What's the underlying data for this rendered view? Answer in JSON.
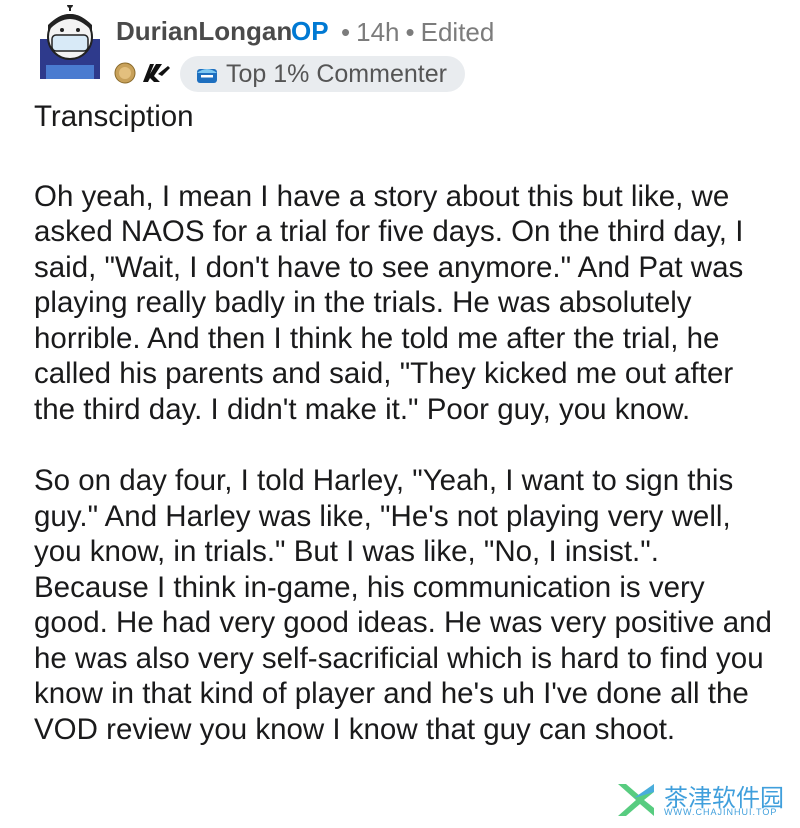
{
  "comment": {
    "author": "DurianLongan",
    "op_label": "OP",
    "age": "14h",
    "edited_label": "Edited",
    "badge": {
      "label": "Top 1% Commenter",
      "icon": "commenter-badge-icon"
    },
    "flair_icons": [
      "edg-logo-icon",
      "paper-rex-logo-icon"
    ],
    "paragraphs": [
      "Transciption",
      "Oh yeah, I mean I have a story about this but like, we asked NAOS for a trial for five days. On the third day, I said, \"Wait, I don't have to see anymore.\" And Pat was playing really badly in the trials. He was absolutely horrible. And then I think he told me after the trial, he called his parents and said, \"They kicked me out after the third day. I didn't make it.\" Poor guy, you know.",
      "So on day four, I told Harley, \"Yeah, I want to sign this guy.\" And Harley was like, \"He's not playing very well, you know, in trials.\" But I was like, \"No, I insist.\". Because I think in-game, his communication is very good. He had very good ideas. He was very positive and he was also very self-sacrificial which is hard to find you know in that kind of player and he's uh I've done all the VOD review you know I know that guy can shoot."
    ]
  },
  "watermark": {
    "name": "茶津软件园",
    "url": "WWW.CHAJINHUI.TOP"
  },
  "colors": {
    "op_blue": "#0079d3",
    "meta_gray": "#7c7c7c",
    "badge_bg": "#e9ecef"
  }
}
